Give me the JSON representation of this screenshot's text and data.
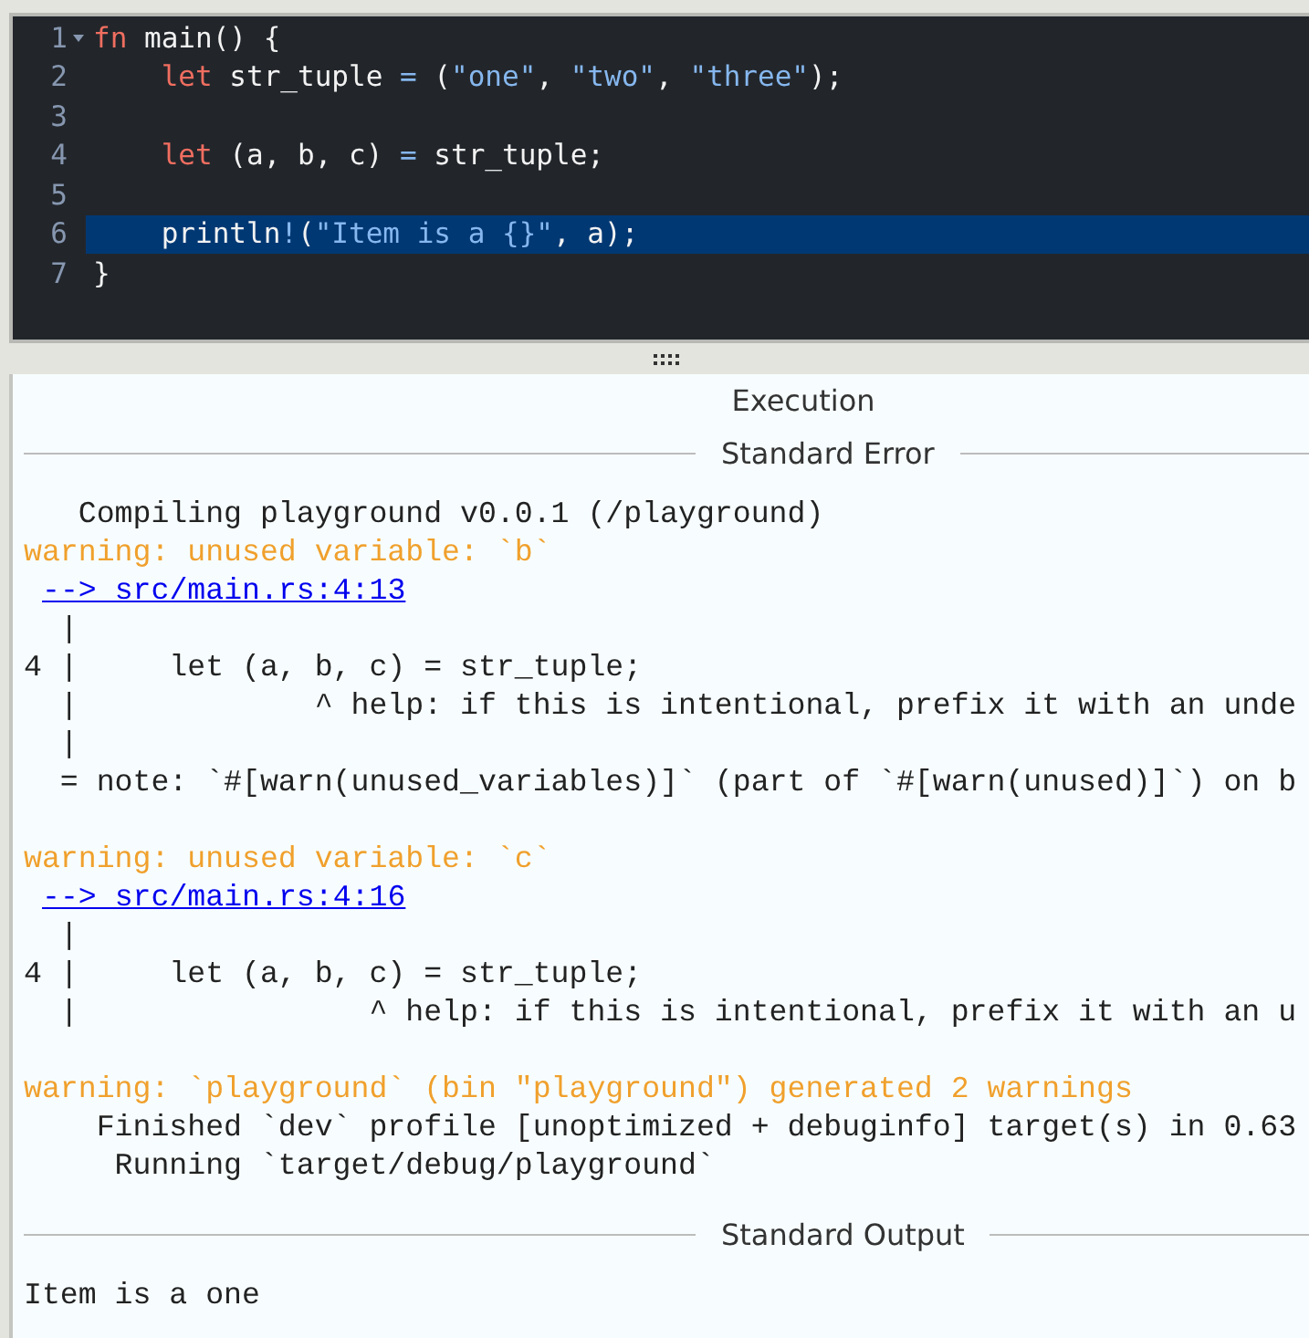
{
  "editor": {
    "lines": [
      {
        "number": "1",
        "foldable": true,
        "selected": false,
        "tokens": [
          {
            "kind": "kw",
            "text": "fn"
          },
          {
            "kind": "plain",
            "text": " main() {"
          }
        ]
      },
      {
        "number": "2",
        "foldable": false,
        "selected": false,
        "tokens": [
          {
            "kind": "kw",
            "text": "    let"
          },
          {
            "kind": "plain",
            "text": " str_tuple "
          },
          {
            "kind": "op",
            "text": "="
          },
          {
            "kind": "plain",
            "text": " ("
          },
          {
            "kind": "str",
            "text": "\"one\""
          },
          {
            "kind": "plain",
            "text": ", "
          },
          {
            "kind": "str",
            "text": "\"two\""
          },
          {
            "kind": "plain",
            "text": ", "
          },
          {
            "kind": "str",
            "text": "\"three\""
          },
          {
            "kind": "plain",
            "text": ");"
          }
        ]
      },
      {
        "number": "3",
        "foldable": false,
        "selected": false
      },
      {
        "number": "4",
        "foldable": false,
        "selected": false,
        "tokens": [
          {
            "kind": "kw",
            "text": "    let"
          },
          {
            "kind": "plain",
            "text": " (a, b, c) "
          },
          {
            "kind": "op",
            "text": "="
          },
          {
            "kind": "plain",
            "text": " str_tuple;"
          }
        ]
      },
      {
        "number": "5",
        "foldable": false,
        "selected": false
      },
      {
        "number": "6",
        "foldable": false,
        "selected": true,
        "tokens": [
          {
            "kind": "plain",
            "text": "    println"
          },
          {
            "kind": "op",
            "text": "!"
          },
          {
            "kind": "plain",
            "text": "("
          },
          {
            "kind": "str",
            "text": "\"Item is a {}\""
          },
          {
            "kind": "plain",
            "text": ", a);"
          }
        ]
      },
      {
        "number": "7",
        "foldable": false,
        "selected": false,
        "tokens": [
          {
            "kind": "plain",
            "text": "}"
          }
        ]
      }
    ]
  },
  "output": {
    "title": "Execution",
    "sections": [
      {
        "heading": "Standard Error",
        "lines": [
          {
            "kind": "plain",
            "text": "   Compiling playground v0.0.1 (/playground)"
          },
          {
            "kind": "warning",
            "text": "warning: unused variable: `b`"
          },
          {
            "kind": "link",
            "text": "--> src/main.rs:4:13"
          },
          {
            "kind": "plain",
            "text": "  |"
          },
          {
            "kind": "plain",
            "text": "4 |     let (a, b, c) = str_tuple;"
          },
          {
            "kind": "plain",
            "text": "  |             ^ help: if this is intentional, prefix it with an unde"
          },
          {
            "kind": "plain",
            "text": "  |"
          },
          {
            "kind": "plain",
            "text": "  = note: `#[warn(unused_variables)]` (part of `#[warn(unused)]`) on b"
          },
          {
            "kind": "blank"
          },
          {
            "kind": "warning",
            "text": "warning: unused variable: `c`"
          },
          {
            "kind": "link",
            "text": "--> src/main.rs:4:16"
          },
          {
            "kind": "plain",
            "text": "  |"
          },
          {
            "kind": "plain",
            "text": "4 |     let (a, b, c) = str_tuple;"
          },
          {
            "kind": "plain",
            "text": "  |                ^ help: if this is intentional, prefix it with an u"
          },
          {
            "kind": "blank"
          },
          {
            "kind": "warning",
            "text": "warning: `playground` (bin \"playground\") generated 2 warnings"
          },
          {
            "kind": "plain",
            "text": "    Finished `dev` profile [unoptimized + debuginfo] target(s) in 0.63"
          },
          {
            "kind": "plain",
            "text": "     Running `target/debug/playground`"
          }
        ]
      },
      {
        "heading": "Standard Output",
        "lines": [
          {
            "kind": "plain",
            "text": "Item is a one"
          }
        ]
      }
    ]
  }
}
